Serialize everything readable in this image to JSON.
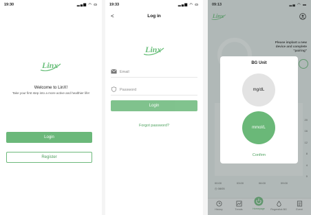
{
  "screen1": {
    "status_time": "19:30",
    "logo_text": "Linx",
    "welcome": "Welcome to LinX!",
    "tagline": "Take your first step into a more active and healthier life!",
    "login_label": "Login",
    "register_label": "Register"
  },
  "screen2": {
    "status_time": "19:33",
    "back_glyph": "<",
    "title": "Log in",
    "logo_text": "Linx",
    "email_placeholder": "Email",
    "password_placeholder": "Password",
    "login_label": "Login",
    "forgot_label": "Forgot password?"
  },
  "screen3": {
    "status_time": "09:13",
    "logo_text": "Linx",
    "notice_line1": "Please implant a new",
    "notice_line2": "device and complete",
    "notice_line3": "\"pairing\"",
    "modal_title": "BG Unit",
    "option_mgdl": "mg/dL",
    "option_mmol": "mmol/L",
    "confirm_label": "Confirm",
    "y_ticks": [
      "20",
      "16",
      "12",
      "8",
      "4",
      "0"
    ],
    "x_ticks": [
      "00:00",
      "03:00",
      "06:00",
      "09:00"
    ],
    "date_label": "08/05",
    "tabs": [
      "History",
      "Trends",
      "Homepage",
      "Fingerstick BG",
      "Event"
    ]
  },
  "colors": {
    "brand_green": "#6bb87a",
    "selected_option": "#6ab878",
    "unselected_option": "#e3e3e3"
  }
}
